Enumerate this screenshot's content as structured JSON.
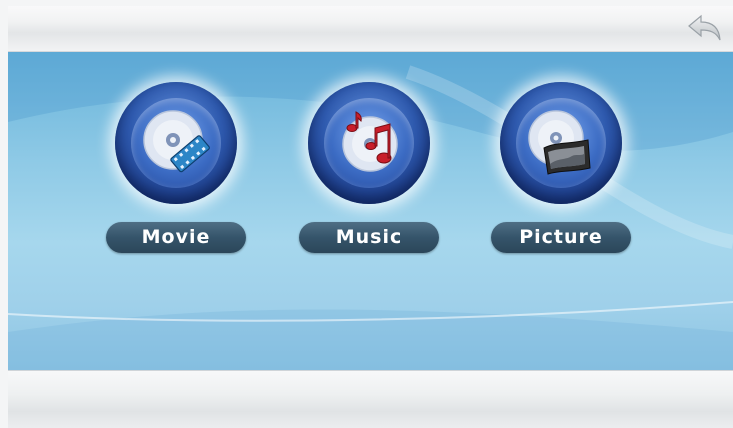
{
  "menu": {
    "items": [
      {
        "label": "Movie",
        "icon": "movie-disc-film-icon"
      },
      {
        "label": "Music",
        "icon": "music-disc-notes-icon"
      },
      {
        "label": "Picture",
        "icon": "picture-disc-photo-icon"
      }
    ]
  },
  "header": {
    "back_icon": "back-arrow-icon"
  },
  "colors": {
    "background_top": "#68b3da",
    "background_bottom": "#9fd0ea",
    "orb": "#2f5bb0",
    "pill": "#35546a"
  }
}
